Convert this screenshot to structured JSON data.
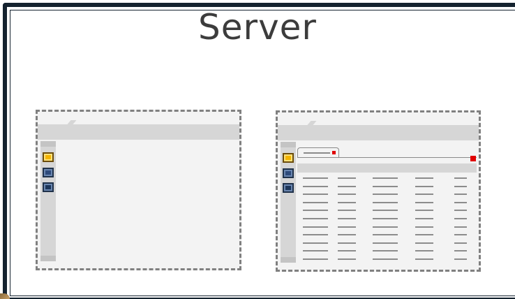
{
  "header": {
    "title": "Server"
  },
  "colors": {
    "frame": "#14222f",
    "window_bg": "#f3f3f3",
    "chrome": "#d6d6d6",
    "active_button": "#f4b400",
    "button": "#2e4a7a",
    "close_marker": "#e00000"
  },
  "windows": [
    {
      "id": "window-left",
      "sidebar_buttons": [
        "active",
        "default",
        "default"
      ],
      "has_table": false
    },
    {
      "id": "window-right",
      "sidebar_buttons": [
        "active",
        "default",
        "default"
      ],
      "has_table": true,
      "tab_count": 1,
      "table_columns": 5,
      "table_rows": 11
    }
  ],
  "icons": [
    "yellow-square-button-icon",
    "blue-square-button-icon",
    "close-marker-icon"
  ]
}
